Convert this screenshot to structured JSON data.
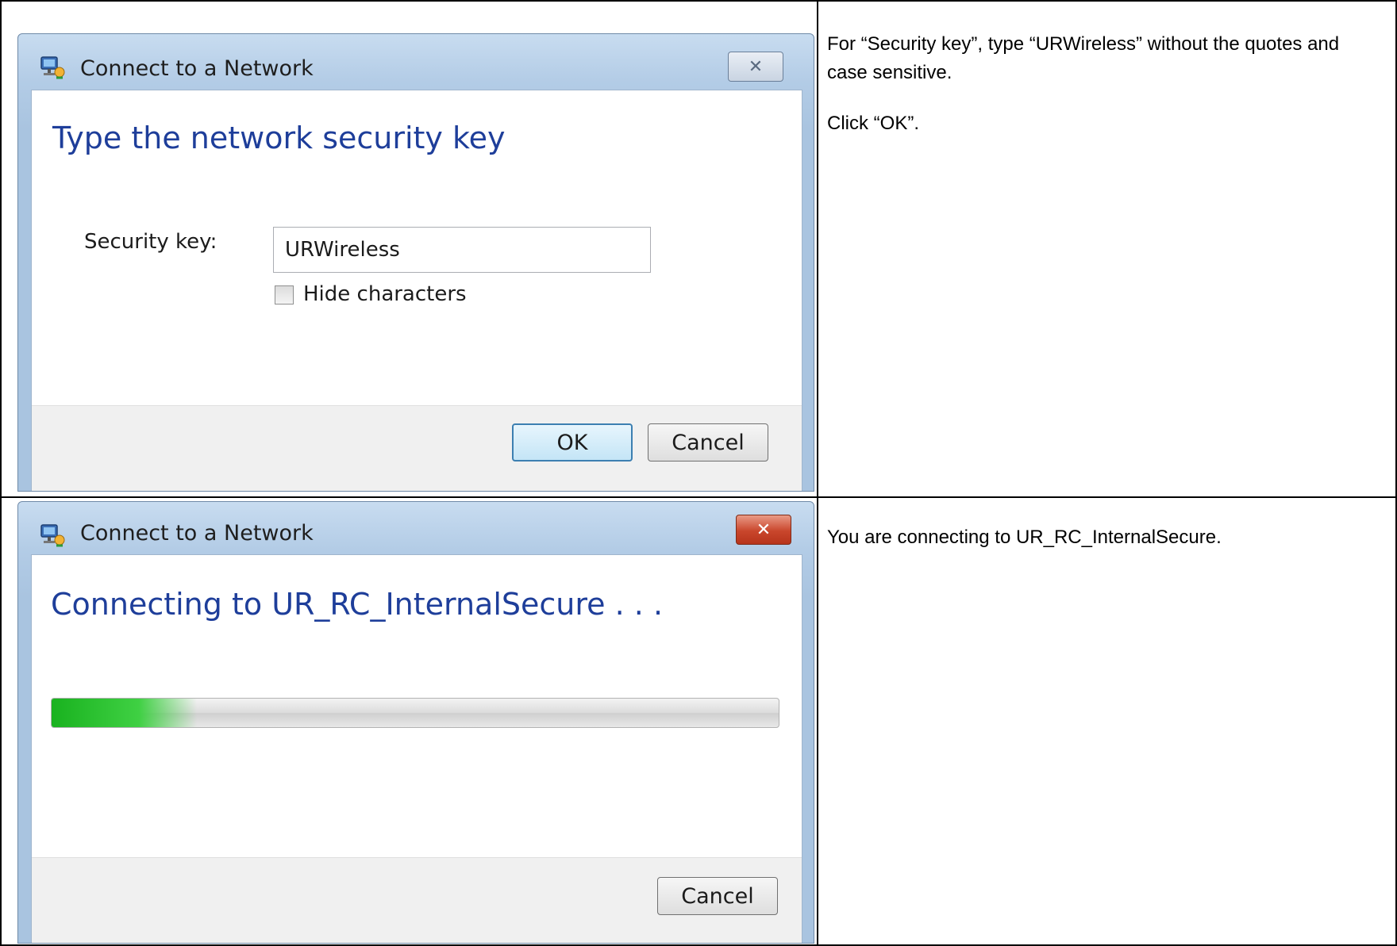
{
  "step1": {
    "dialog": {
      "title": "Connect to a Network",
      "close_glyph": "✕",
      "heading": "Type the network security key",
      "security_key_label": "Security key:",
      "security_key_value": "URWireless",
      "hide_characters_label": "Hide characters",
      "hide_characters_checked": false,
      "ok_label": "OK",
      "cancel_label": "Cancel"
    },
    "instructions": [
      "For “Security key”, type “URWireless” without the quotes and case sensitive.",
      "Click “OK”."
    ]
  },
  "step2": {
    "dialog": {
      "title": "Connect to a Network",
      "close_glyph": "✕",
      "heading": "Connecting to UR_RC_InternalSecure . . .",
      "progress_fraction": 0.2,
      "cancel_label": "Cancel"
    },
    "instructions": [
      "You are connecting to UR_RC_InternalSecure."
    ]
  },
  "colors": {
    "heading_blue": "#1e3e9a",
    "close_red": "#c9462c",
    "progress_green": "#19b21f",
    "default_button_border": "#3c7fb1"
  },
  "icons": {
    "app_icon": "network-connection-icon",
    "close_icon": "close-icon",
    "checkbox": "checkbox-unchecked"
  }
}
